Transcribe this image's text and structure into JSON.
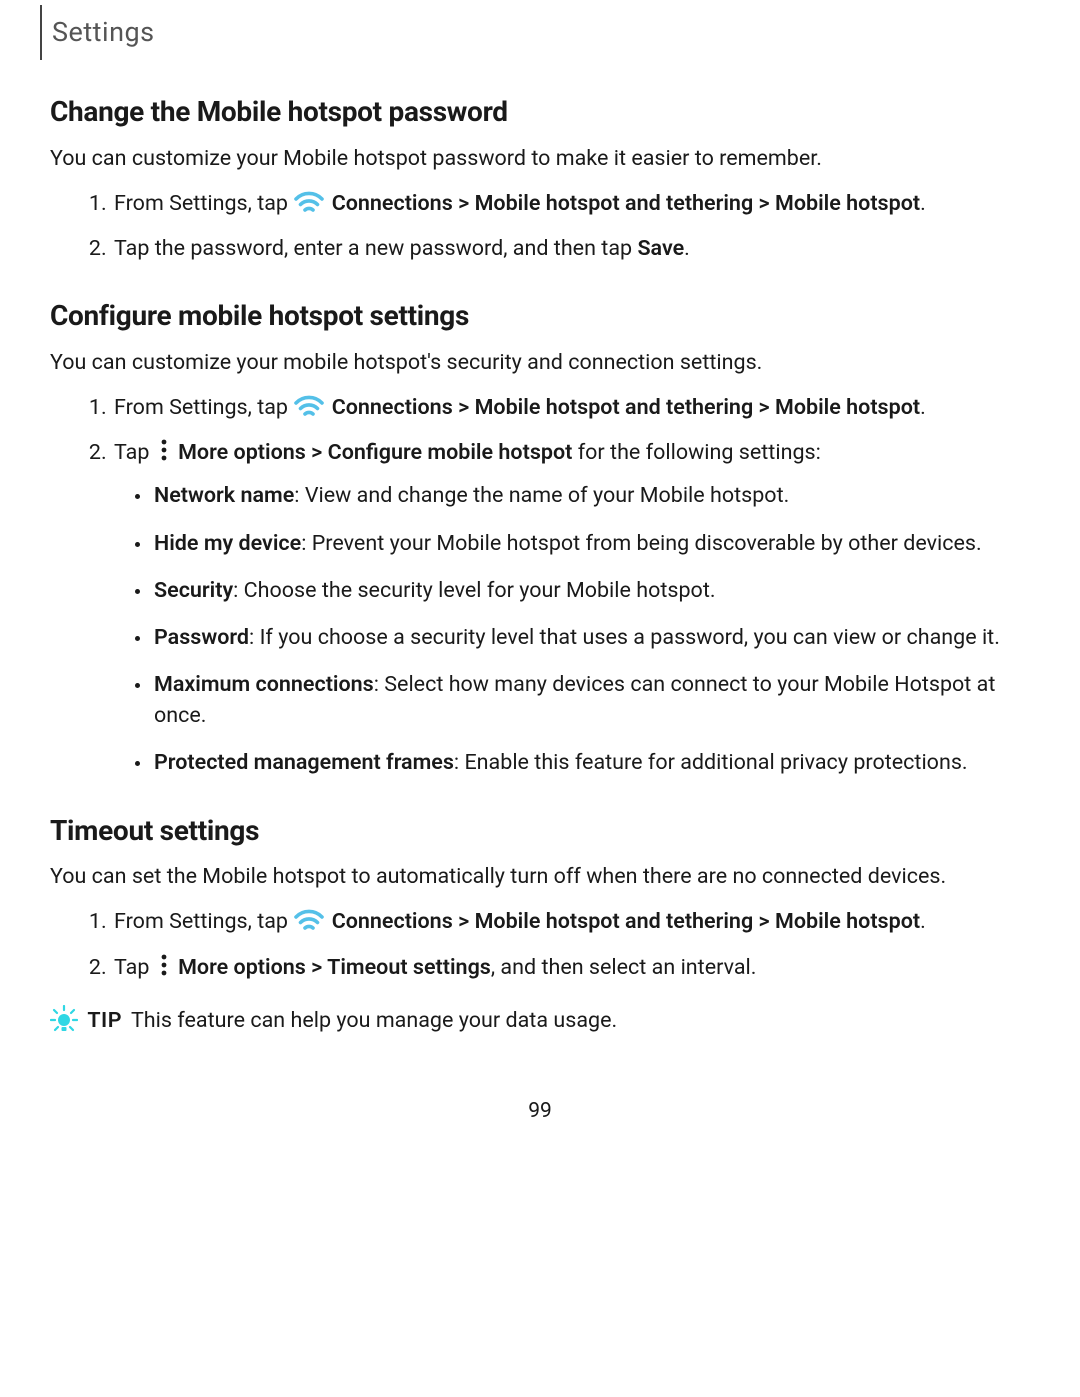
{
  "header": "Settings",
  "page_number": "99",
  "icons": {
    "wifi_color": "#54c0e8",
    "tip_color": "#2fd7e4"
  },
  "tip": {
    "label": "TIP",
    "text": "This feature can help you manage your data usage."
  },
  "s1": {
    "heading": "Change the Mobile hotspot password",
    "intro": "You can customize your Mobile hotspot password to make it easier to remember.",
    "step1_a": "From Settings, tap ",
    "step1_b": "Connections",
    "step1_c": " > ",
    "step1_d": "Mobile hotspot and tethering",
    "step1_e": " > ",
    "step1_f": "Mobile hotspot",
    "step1_g": ".",
    "step2_a": "Tap the password, enter a new password, and then tap ",
    "step2_b": "Save",
    "step2_c": "."
  },
  "s2": {
    "heading": "Configure mobile hotspot settings",
    "intro": "You can customize your mobile hotspot's security and connection settings.",
    "step1_a": "From Settings, tap ",
    "step1_b": "Connections",
    "step1_c": " > ",
    "step1_d": "Mobile hotspot and tethering",
    "step1_e": " > ",
    "step1_f": "Mobile hotspot",
    "step1_g": ".",
    "step2_a": "Tap ",
    "step2_b": "More options",
    "step2_c": " > ",
    "step2_d": "Configure mobile hotspot",
    "step2_e": " for the following settings:",
    "b1_label": "Network name",
    "b1_text": ": View and change the name of your Mobile hotspot.",
    "b2_label": "Hide my device",
    "b2_text": ": Prevent your Mobile hotspot from being discoverable by other devices.",
    "b3_label": "Security",
    "b3_text": ": Choose the security level for your Mobile hotspot.",
    "b4_label": "Password",
    "b4_text": ": If you choose a security level that uses a password, you can view or change it.",
    "b5_label": "Maximum connections",
    "b5_text": ": Select how many devices can connect to your Mobile Hotspot at once.",
    "b6_label": "Protected management frames",
    "b6_text": ": Enable this feature for additional privacy protections."
  },
  "s3": {
    "heading": "Timeout settings",
    "intro": "You can set the Mobile hotspot to automatically turn off when there are no connected devices.",
    "step1_a": "From Settings, tap ",
    "step1_b": "Connections",
    "step1_c": " > ",
    "step1_d": "Mobile hotspot and tethering",
    "step1_e": " > ",
    "step1_f": "Mobile hotspot",
    "step1_g": ".",
    "step2_a": "Tap ",
    "step2_b": "More options",
    "step2_c": " > ",
    "step2_d": "Timeout settings",
    "step2_e": ", and then select an interval."
  }
}
